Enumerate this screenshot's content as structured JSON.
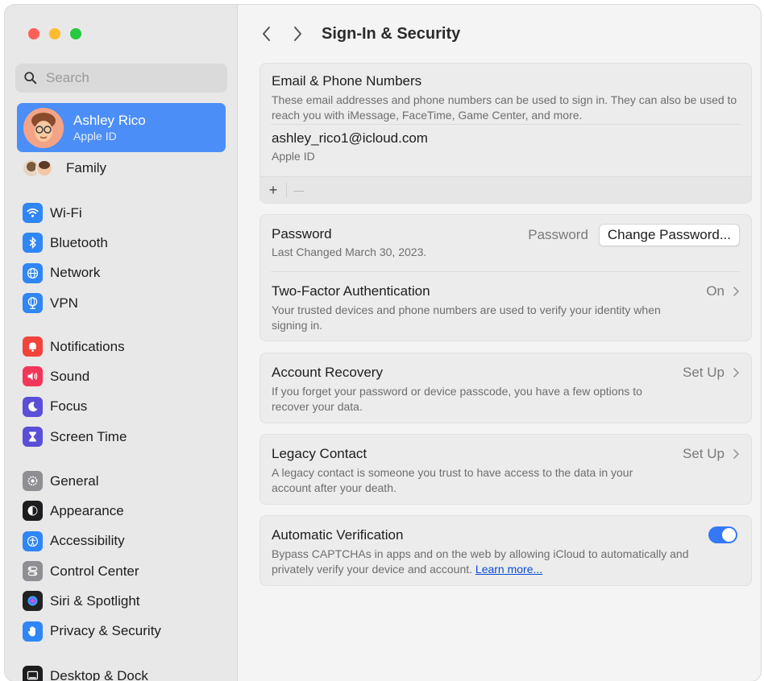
{
  "sidebar": {
    "search_placeholder": "Search",
    "account": {
      "name": "Ashley Rico",
      "subtitle": "Apple ID"
    },
    "family_label": "Family",
    "groups": [
      [
        {
          "label": "Wi-Fi",
          "icon": "wifi-icon",
          "color": "#2f86f6"
        },
        {
          "label": "Bluetooth",
          "icon": "bluetooth-icon",
          "color": "#2f86f6"
        },
        {
          "label": "Network",
          "icon": "globe-icon",
          "color": "#2f86f6"
        },
        {
          "label": "VPN",
          "icon": "vpn-globe-icon",
          "color": "#2f86f6"
        }
      ],
      [
        {
          "label": "Notifications",
          "icon": "bell-icon",
          "color": "#f2443b"
        },
        {
          "label": "Sound",
          "icon": "speaker-icon",
          "color": "#f2365a"
        },
        {
          "label": "Focus",
          "icon": "moon-icon",
          "color": "#5a4fd6"
        },
        {
          "label": "Screen Time",
          "icon": "hourglass-icon",
          "color": "#5a4fd6"
        }
      ],
      [
        {
          "label": "General",
          "icon": "gear-icon",
          "color": "#8e8e93"
        },
        {
          "label": "Appearance",
          "icon": "appearance-icon",
          "color": "#1d1d1f"
        },
        {
          "label": "Accessibility",
          "icon": "accessibility-icon",
          "color": "#2f86f6"
        },
        {
          "label": "Control Center",
          "icon": "control-center-icon",
          "color": "#8e8e93"
        },
        {
          "label": "Siri & Spotlight",
          "icon": "siri-icon",
          "color": "#333333"
        },
        {
          "label": "Privacy & Security",
          "icon": "hand-icon",
          "color": "#2f86f6"
        }
      ]
    ],
    "cutoff_label": "Desktop & Dock"
  },
  "main": {
    "title": "Sign-In & Security",
    "email_card": {
      "title": "Email & Phone Numbers",
      "desc": "These email addresses and phone numbers can be used to sign in. They can also be used to reach you with iMessage, FaceTime, Game Center, and more.",
      "email": "ashley_rico1@icloud.com",
      "email_sub": "Apple ID",
      "add": "+",
      "remove": "—"
    },
    "password_card": {
      "password_title": "Password",
      "password_sub": "Last Changed March 30, 2023.",
      "password_value": "Password",
      "change_button": "Change Password...",
      "tfa_title": "Two-Factor Authentication",
      "tfa_desc": "Your trusted devices and phone numbers are used to verify your identity when signing in.",
      "tfa_status": "On"
    },
    "recovery_card": {
      "title": "Account Recovery",
      "desc": "If you forget your password or device passcode, you have a few options to recover your data.",
      "action": "Set Up"
    },
    "legacy_card": {
      "title": "Legacy Contact",
      "desc": "A legacy contact is someone you trust to have access to the data in your account after your death.",
      "action": "Set Up"
    },
    "verification_card": {
      "title": "Automatic Verification",
      "desc": "Bypass CAPTCHAs in apps and on the web by allowing iCloud to automatically and privately verify your device and account.",
      "link": "Learn more...",
      "toggle_on": true
    }
  }
}
